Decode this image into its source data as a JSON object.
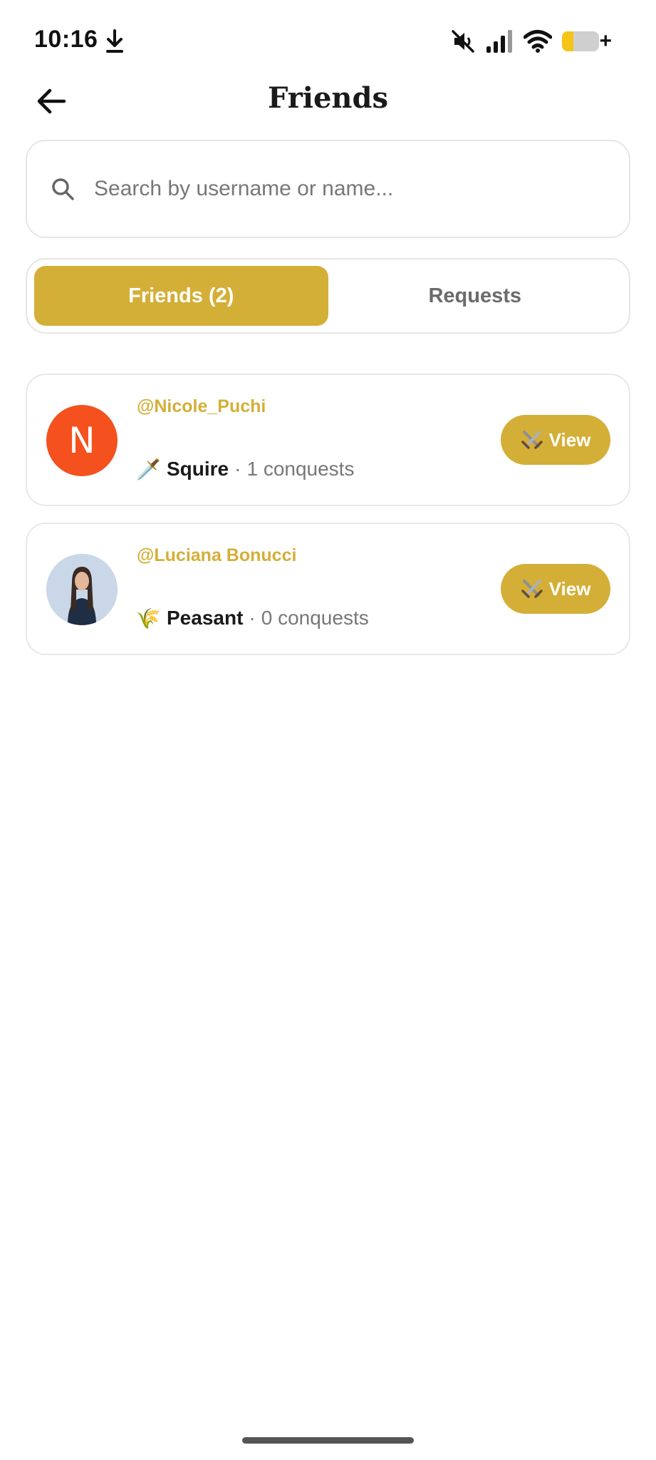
{
  "status_bar": {
    "time": "10:16",
    "battery_level": 0.3,
    "icons": [
      "download-icon",
      "mute-icon",
      "signal-icon",
      "wifi-icon",
      "battery-icon"
    ]
  },
  "header": {
    "title": "Friends",
    "back_icon": "arrow-left-icon"
  },
  "search": {
    "placeholder": "Search by username or name...",
    "value": ""
  },
  "tabs": [
    {
      "label": "Friends (2)",
      "active": true
    },
    {
      "label": "Requests",
      "active": false
    }
  ],
  "friends": [
    {
      "username": "@Nicole_Puchi",
      "avatar_letter": "N",
      "avatar_color": "#f4511e",
      "rank_icon": "dagger-emoji",
      "rank_emoji": "🗡️",
      "rank": "Squire",
      "separator": "·",
      "conquests": "1 conquests",
      "view_label": "View",
      "view_icon": "crossed-swords-icon"
    },
    {
      "username": "@Luciana Bonucci",
      "avatar_letter": "",
      "rank_icon": "wheat-emoji",
      "rank_emoji": "🌾",
      "rank": "Peasant",
      "separator": "·",
      "conquests": "0 conquests",
      "view_label": "View",
      "view_icon": "crossed-swords-icon"
    }
  ],
  "colors": {
    "accent": "#d4af37",
    "avatar_n": "#f4511e",
    "muted_text": "#777777"
  }
}
